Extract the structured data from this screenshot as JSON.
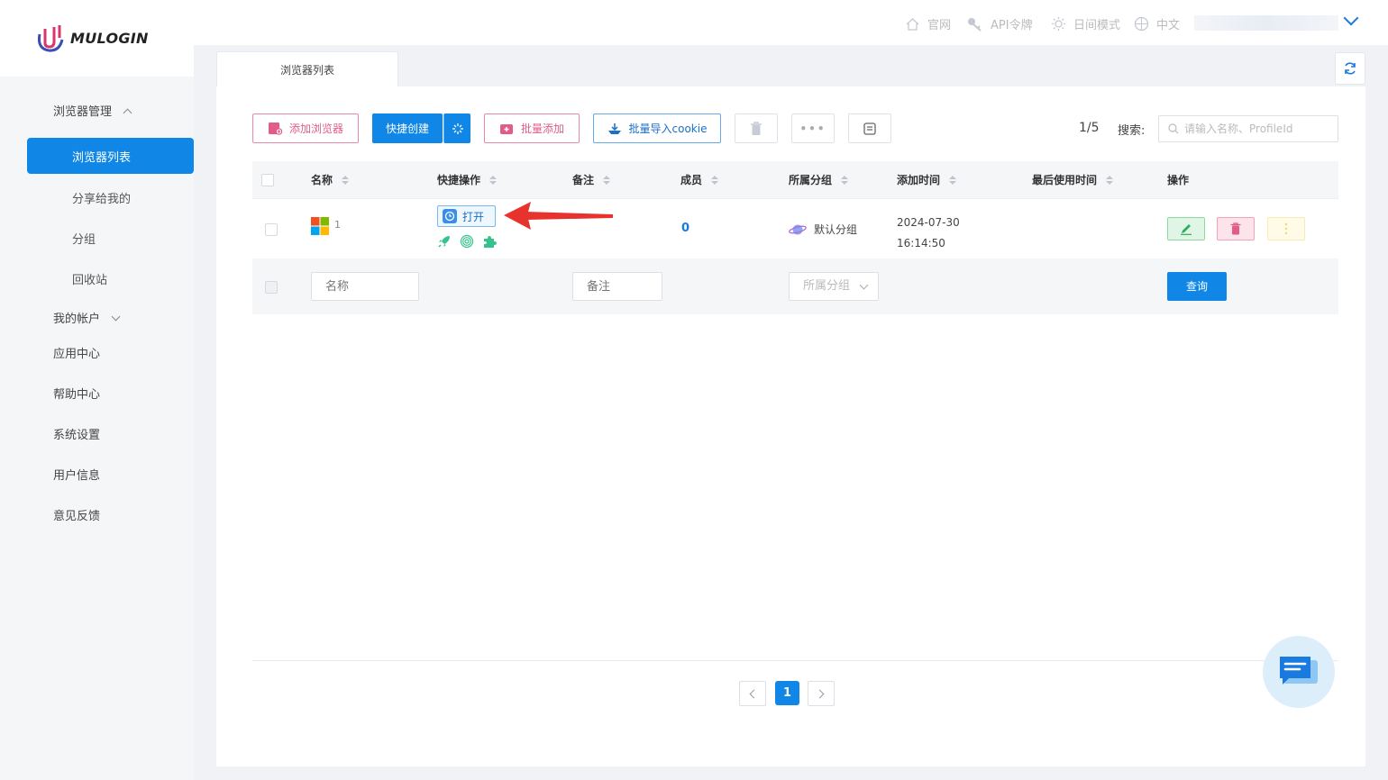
{
  "app": {
    "logo_text": "MULOGIN"
  },
  "header": {
    "links": [
      {
        "label": "官网",
        "icon": "home-icon"
      },
      {
        "label": "API令牌",
        "icon": "key-icon"
      },
      {
        "label": "日间模式",
        "icon": "sun-icon"
      },
      {
        "label": "中文",
        "icon": "globe-icon"
      }
    ]
  },
  "sidebar": {
    "browser_mgmt": "浏览器管理",
    "browser_list": "浏览器列表",
    "shared_to_me": "分享给我的",
    "groups": "分组",
    "recycle_bin": "回收站",
    "my_account": "我的帐户",
    "app_center": "应用中心",
    "help_center": "帮助中心",
    "settings": "系统设置",
    "user_info": "用户信息",
    "feedback": "意见反馈"
  },
  "tabs": {
    "active": "浏览器列表"
  },
  "toolbar": {
    "add_browser": "添加浏览器",
    "quick_create": "快捷创建",
    "batch_add": "批量添加",
    "batch_import_cookie": "批量导入cookie",
    "page_indicator": "1/5",
    "search_label": "搜索:",
    "search_placeholder": "请输入名称、ProfileId"
  },
  "table": {
    "columns": {
      "name": "名称",
      "quick_ops": "快捷操作",
      "remark": "备注",
      "members": "成员",
      "group": "所属分组",
      "added_time": "添加时间",
      "last_used": "最后使用时间",
      "actions": "操作"
    },
    "rows": [
      {
        "name": "1",
        "open_label": "打开",
        "members": "0",
        "group": "默认分组",
        "added_date": "2024-07-30",
        "added_clock": "16:14:50"
      }
    ]
  },
  "filters": {
    "name_placeholder": "名称",
    "remark_placeholder": "备注",
    "group_placeholder": "所属分组",
    "query_label": "查询"
  },
  "pagination": {
    "current": "1"
  },
  "colors": {
    "accent": "#1086e6",
    "pink": "#e15c8a",
    "annotation": "#e8322e"
  }
}
